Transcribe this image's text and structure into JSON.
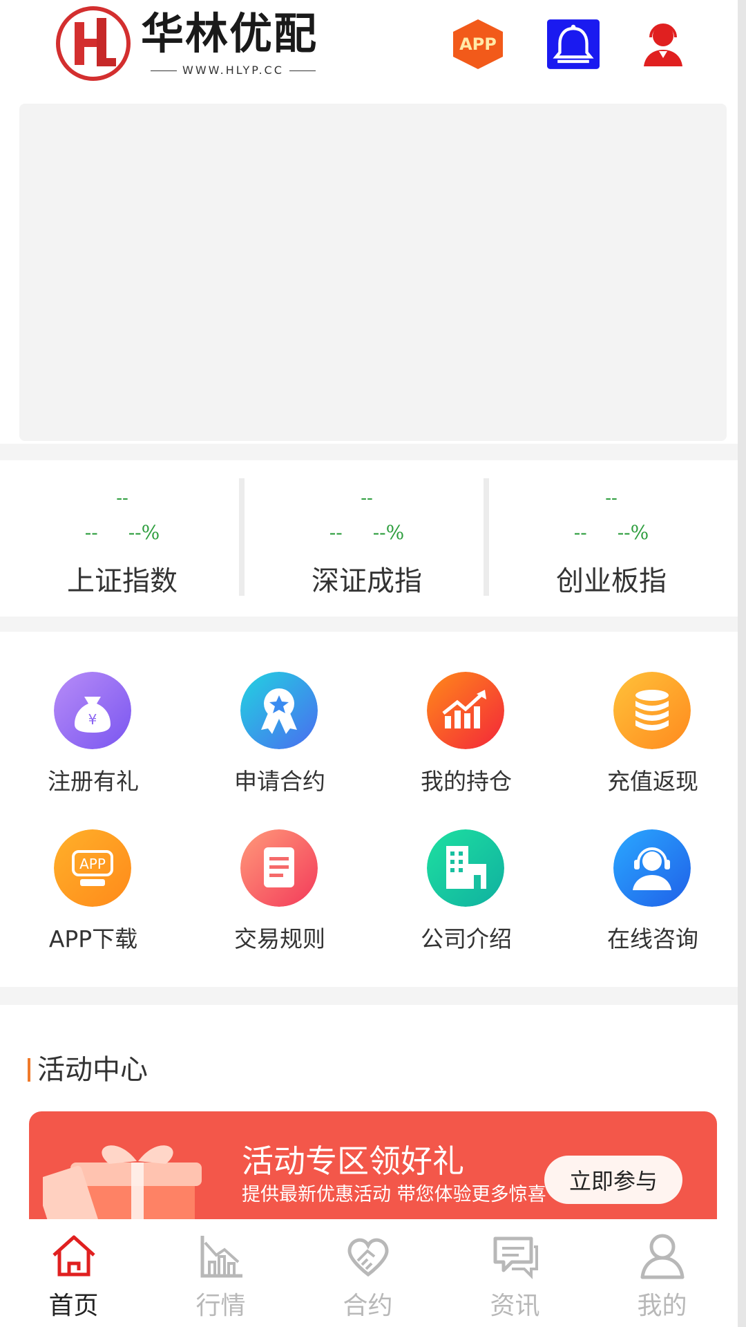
{
  "header": {
    "logo_text": "华林优配",
    "logo_url": "WWW.HLYP.CC",
    "app_badge": "APP",
    "icons": [
      "app-hexagon-icon",
      "bell-icon",
      "customer-service-icon"
    ]
  },
  "indices": [
    {
      "value": "--",
      "change": "--",
      "percent": "--%",
      "name": "上证指数"
    },
    {
      "value": "--",
      "change": "--",
      "percent": "--%",
      "name": "深证成指"
    },
    {
      "value": "--",
      "change": "--",
      "percent": "--%",
      "name": "创业板指"
    }
  ],
  "grid": [
    {
      "label": "注册有礼",
      "icon": "money-bag-icon"
    },
    {
      "label": "申请合约",
      "icon": "award-ribbon-icon"
    },
    {
      "label": "我的持仓",
      "icon": "chart-growth-icon"
    },
    {
      "label": "充值返现",
      "icon": "coin-stack-icon"
    },
    {
      "label": "APP下载",
      "icon": "app-download-icon"
    },
    {
      "label": "交易规则",
      "icon": "document-icon"
    },
    {
      "label": "公司介绍",
      "icon": "building-icon"
    },
    {
      "label": "在线咨询",
      "icon": "headset-icon"
    }
  ],
  "activity": {
    "title": "活动中心",
    "promo_title": "活动专区领好礼",
    "promo_subtitle": "提供最新优惠活动 带您体验更多惊喜",
    "promo_button": "立即参与"
  },
  "nav": [
    {
      "label": "首页",
      "icon": "home-icon",
      "active": true
    },
    {
      "label": "行情",
      "icon": "market-chart-icon",
      "active": false
    },
    {
      "label": "合约",
      "icon": "handshake-icon",
      "active": false
    },
    {
      "label": "资讯",
      "icon": "chat-icon",
      "active": false
    },
    {
      "label": "我的",
      "icon": "user-icon",
      "active": false
    }
  ],
  "colors": {
    "brand_red": "#d32f2f",
    "index_green": "#2e9e3e",
    "promo_red": "#f3574a",
    "accent_orange": "#f07a2a"
  }
}
